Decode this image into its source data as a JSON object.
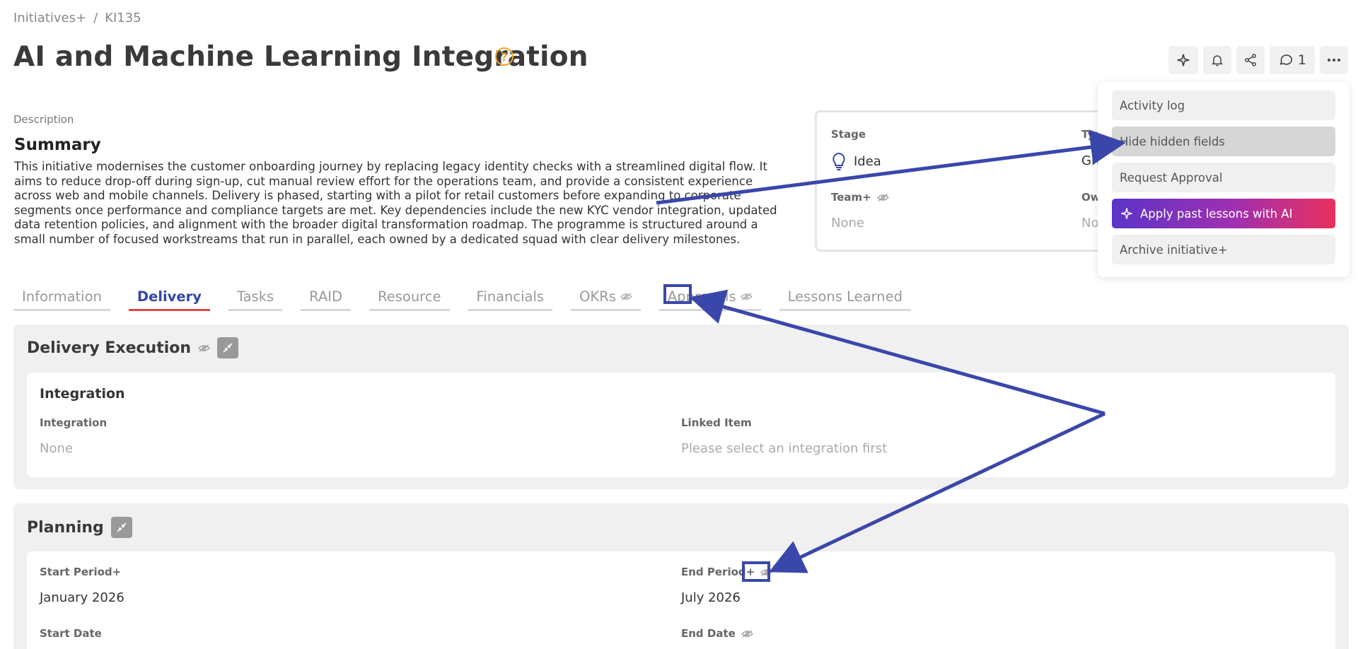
{
  "breadcrumb": {
    "parent": "Initiatives+",
    "separator": "/",
    "current": "KI135"
  },
  "title": "AI and Machine Learning Integration",
  "title_badge": "?",
  "toolbar": {
    "comment_count": "1"
  },
  "description": {
    "label": "Description",
    "summary_title": "Summary",
    "summary_text": "This initiative modernises the customer onboarding journey by replacing legacy identity checks with a streamlined digital flow. It aims to reduce drop-off during sign-up, cut manual review effort for the operations team, and provide a consistent experience across web and mobile channels. Delivery is phased, starting with a pilot for retail customers before expanding to corporate segments once performance and compliance targets are met. Key dependencies include the new KYC vendor integration, updated data retention policies, and alignment with the broader digital transformation roadmap. The programme is structured around a small number of focused workstreams that run in parallel, each owned by a dedicated squad with clear delivery milestones."
  },
  "info_card": {
    "stage_label": "Stage",
    "stage_value": "Idea",
    "type_label": "Typ",
    "type_value": "Gro",
    "team_label": "Team+",
    "team_value": "None",
    "owner_label": "Ow",
    "owner_value": "No"
  },
  "tabs": [
    {
      "label": "Information"
    },
    {
      "label": "Delivery"
    },
    {
      "label": "Tasks"
    },
    {
      "label": "RAID"
    },
    {
      "label": "Resource"
    },
    {
      "label": "Financials"
    },
    {
      "label": "OKRs"
    },
    {
      "label": "Approvals"
    },
    {
      "label": "Lessons Learned"
    }
  ],
  "delivery_execution": {
    "title": "Delivery Execution",
    "card_title": "Integration",
    "integration_label": "Integration",
    "integration_value": "None",
    "linked_item_label": "Linked Item",
    "linked_item_value": "Please select an integration first"
  },
  "planning": {
    "title": "Planning",
    "start_period_label": "Start Period+",
    "start_period_value": "January 2026",
    "end_period_label": "End Period+",
    "end_period_value": "July 2026",
    "start_date_label": "Start Date",
    "end_date_label": "End Date"
  },
  "menu": {
    "items": [
      {
        "label": "Activity log"
      },
      {
        "label": "Hide hidden fields"
      },
      {
        "label": "Request Approval"
      },
      {
        "label": "Apply past lessons with AI"
      },
      {
        "label": "Archive initiative+"
      }
    ]
  },
  "colors": {
    "active_tab_text": "#3344aa",
    "active_tab_underline": "#e0444a",
    "annotation": "#3a47aa",
    "badge": "#f0a32a",
    "ai_gradient_start": "#5a34c8",
    "ai_gradient_end": "#e8305c"
  }
}
